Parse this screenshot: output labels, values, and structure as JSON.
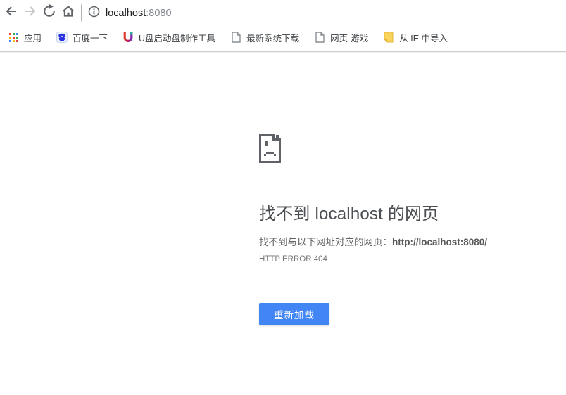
{
  "toolbar": {
    "buttons": {
      "back_icon": "back-arrow-icon",
      "forward_icon": "forward-arrow-icon",
      "reload_icon": "reload-icon",
      "home_icon": "home-icon"
    },
    "omnibox": {
      "security_icon": "info-icon",
      "host": "localhost",
      "port": ":8080"
    }
  },
  "bookmarks_bar": {
    "apps": {
      "label": "应用",
      "icon": "apps-grid-icon"
    },
    "items": [
      {
        "label": "百度一下",
        "icon": "baidu-paw-icon"
      },
      {
        "label": "U盘启动盘制作工具",
        "icon": "u-disk-icon"
      },
      {
        "label": "最新系统下载",
        "icon": "page-icon"
      },
      {
        "label": "网页-游戏",
        "icon": "page-icon"
      },
      {
        "label": "从 IE 中导入",
        "icon": "yellow-folder-icon"
      }
    ]
  },
  "error_page": {
    "icon": "sad-file-icon",
    "title": "找不到 localhost 的网页",
    "message": "找不到与以下网址对应的网页：",
    "failed_url": "http://localhost:8080/",
    "error_code": "HTTP ERROR 404",
    "reload_button": "重新加载"
  },
  "colors": {
    "accent_blue": "#4285f4",
    "icon_gray": "#5f6368",
    "disabled_gray": "#c6c6c6",
    "baidu_blue": "#2932e1",
    "folder_yellow": "#f9d45c"
  }
}
